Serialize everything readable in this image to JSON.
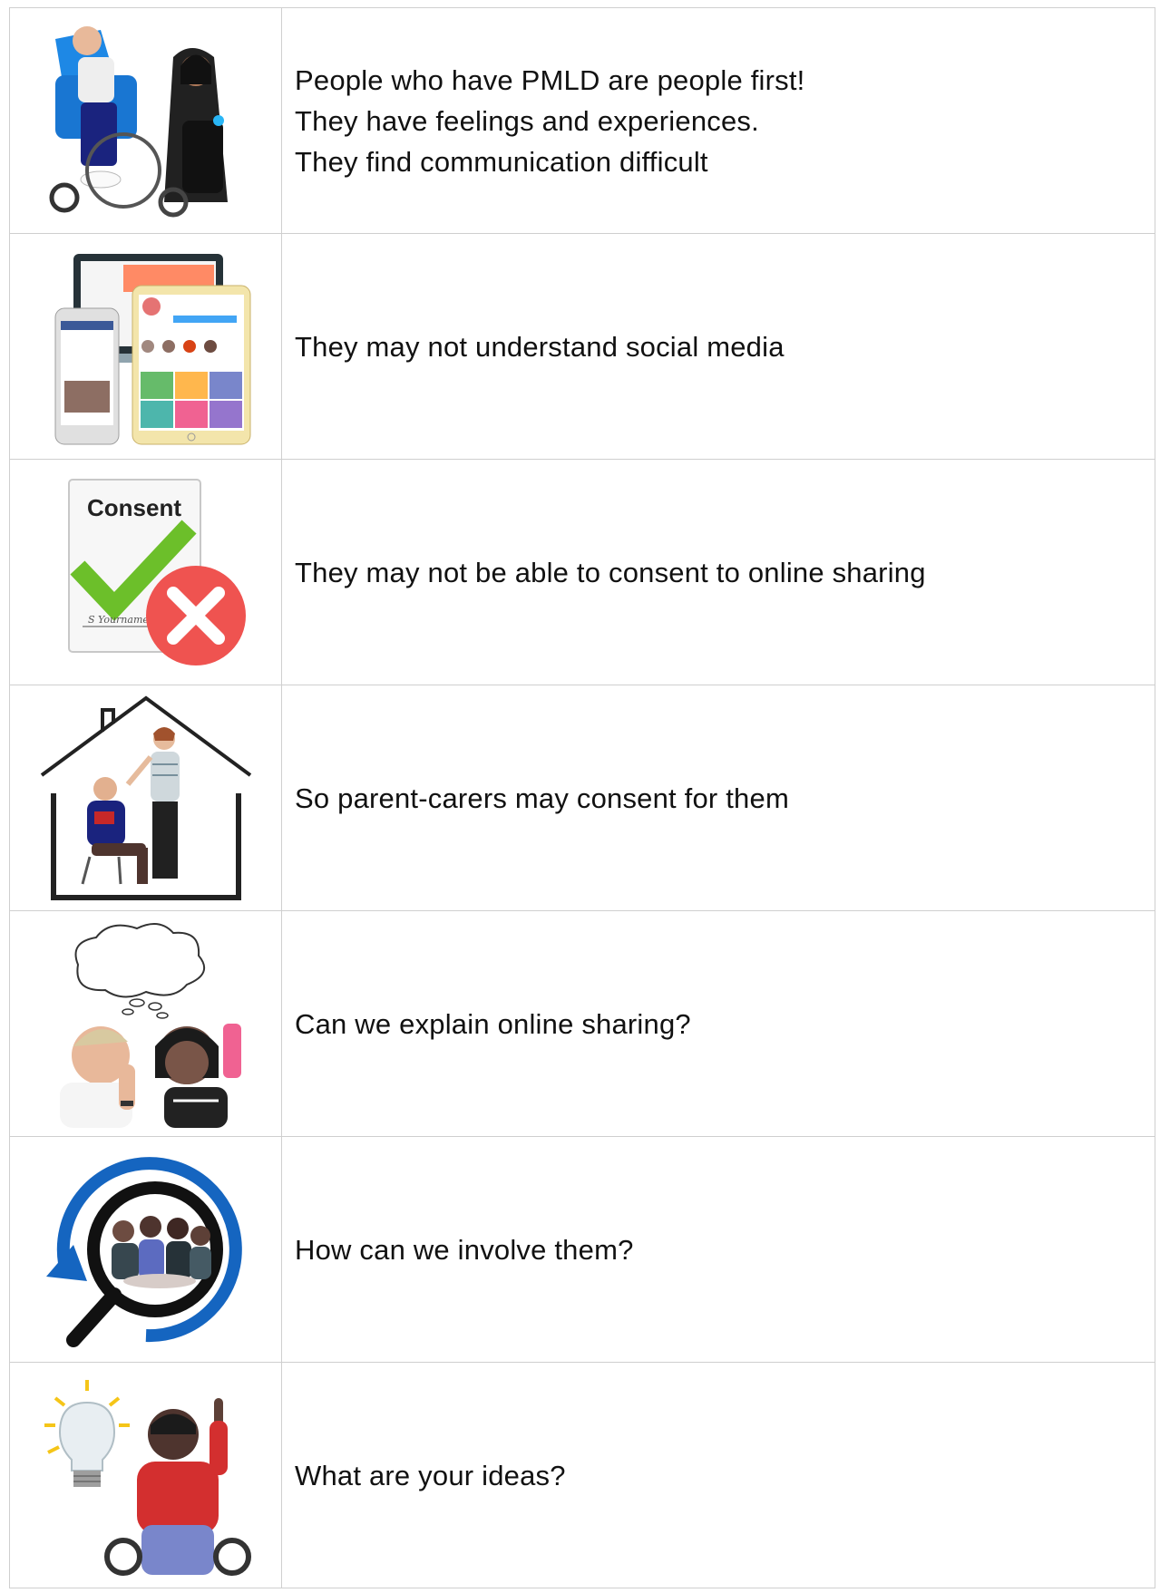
{
  "rows": [
    {
      "id": "pmld-people",
      "icon": "two-wheelchair-users-picture",
      "lines": [
        "People who have PMLD are people first!",
        "They have feelings and experiences.",
        "They find communication difficult"
      ]
    },
    {
      "id": "social-media",
      "icon": "social-media-devices-picture",
      "lines": [
        "They may not understand social media"
      ]
    },
    {
      "id": "consent",
      "icon": "consent-form-picture",
      "lines": [
        "They may not be able to consent to online sharing"
      ],
      "image_text": [
        "Consent",
        "S Yourname"
      ]
    },
    {
      "id": "parent-carers",
      "icon": "house-with-parents-picture",
      "lines": [
        "So parent-carers may consent for them"
      ]
    },
    {
      "id": "explain",
      "icon": "people-thinking-picture",
      "lines": [
        "Can we explain online sharing?"
      ]
    },
    {
      "id": "involve",
      "icon": "magnifier-group-picture",
      "lines": [
        "How can we involve them?"
      ]
    },
    {
      "id": "ideas",
      "icon": "lightbulb-idea-picture",
      "lines": [
        "What are your ideas?"
      ]
    }
  ],
  "colors": {
    "border": "#cfcfcf",
    "text": "#111111",
    "check_green": "#6cbf2a",
    "cross_red": "#ef5350",
    "ring_blue": "#1565c0",
    "bulb_yellow": "#f5c518",
    "shirt_red": "#d32f2f",
    "chair_blue": "#1e88e5"
  }
}
